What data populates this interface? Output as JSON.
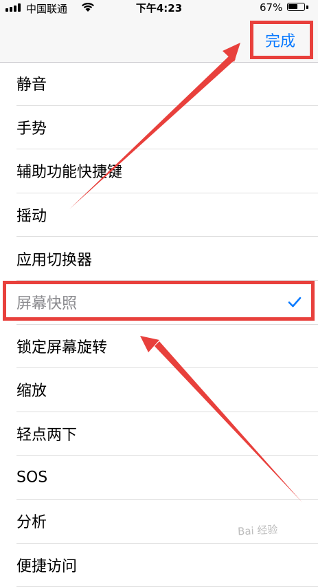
{
  "status_bar": {
    "carrier": "中国联通",
    "time": "下午4:23",
    "battery_percent": "67%",
    "battery_level": 0.67
  },
  "nav": {
    "done_label": "完成",
    "accent_color": "#0a7aff"
  },
  "list": {
    "items": [
      {
        "label": "静音"
      },
      {
        "label": "手势"
      },
      {
        "label": "辅助功能快捷键"
      },
      {
        "label": "摇动"
      },
      {
        "label": "应用切换器"
      },
      {
        "label": "屏幕快照",
        "selected": true
      },
      {
        "label": "锁定屏幕旋转"
      },
      {
        "label": "缩放"
      },
      {
        "label": "轻点两下"
      },
      {
        "label": "SOS"
      },
      {
        "label": "分析"
      },
      {
        "label": "便捷访问"
      }
    ]
  },
  "annotations": {
    "highlight_color": "#e8403c"
  },
  "watermark": {
    "text": "Bai 经验"
  },
  "icons": {
    "checkmark": "checkmark-icon",
    "wifi": "wifi-icon",
    "signal": "signal-icon",
    "battery": "battery-icon"
  }
}
